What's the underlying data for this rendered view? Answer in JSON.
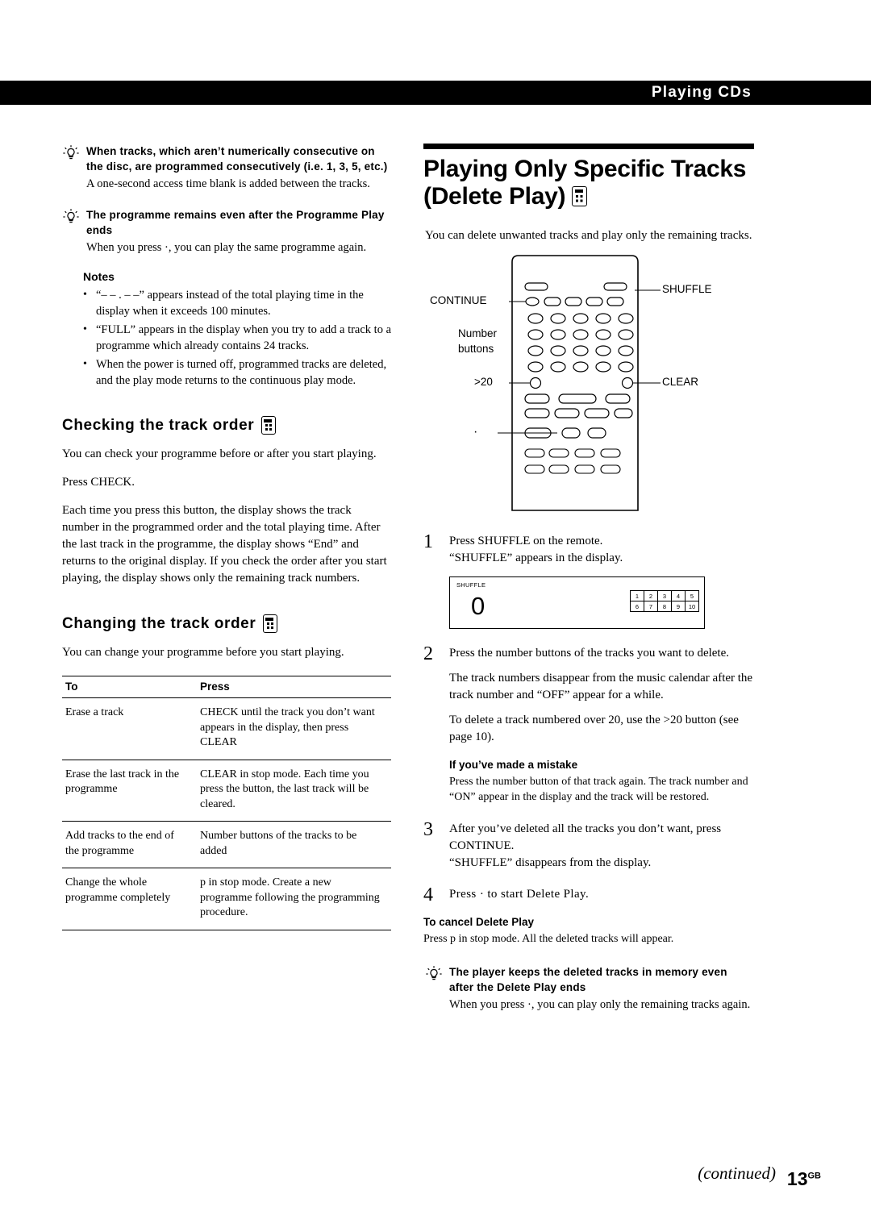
{
  "header": {
    "title": "Playing CDs"
  },
  "left": {
    "tip1": {
      "title": "When tracks, which aren’t numerically consecutive on the disc, are programmed consecutively (i.e. 1, 3, 5, etc.)",
      "body": "A one-second access time blank is added between the tracks."
    },
    "tip2": {
      "title": "The programme remains even after the Programme Play ends",
      "body": "When you press ·, you can play the same programme again."
    },
    "notes_title": "Notes",
    "notes": [
      "“– – . – –” appears instead of the total playing time in the display when it exceeds 100 minutes.",
      "“FULL” appears in the display when you try to add a track to a programme which already contains 24 tracks.",
      "When the power is turned off, programmed tracks are deleted, and the play mode returns to the continuous play mode."
    ],
    "check_head": "Checking the track order",
    "check_p1": "You can check your programme before or after you start playing.",
    "check_p2": "Press CHECK.",
    "check_p3": "Each time you press this button, the display shows the track number in the programmed order and the total playing time. After the last track in the programme, the display shows “End” and returns to the original display. If you check the order after you start playing, the display shows only the remaining track numbers.",
    "change_head": "Changing the track order",
    "change_p1": "You can change your programme before you start playing.",
    "table": {
      "headers": [
        "To",
        "Press"
      ],
      "rows": [
        [
          "Erase a track",
          "CHECK until the track you don’t want appears in the display, then press CLEAR"
        ],
        [
          "Erase the last track in the programme",
          "CLEAR in stop mode. Each time you press the button, the last track will be cleared."
        ],
        [
          "Add tracks to the end of the programme",
          "Number buttons of the tracks to be added"
        ],
        [
          "Change the whole programme completely",
          "p in stop mode. Create a new programme following the programming procedure."
        ]
      ]
    }
  },
  "right": {
    "title_line1": "Playing Only Specific Tracks",
    "title_line2": "(Delete Play)",
    "intro": "You can delete unwanted tracks and play only the remaining tracks.",
    "diagram": {
      "labels": {
        "continue": "CONTINUE",
        "number_buttons_l1": "Number",
        "number_buttons_l2": "buttons",
        "over20": ">20",
        "play": "·",
        "shuffle": "SHUFFLE",
        "clear": "CLEAR"
      }
    },
    "steps": [
      {
        "num": "1",
        "paras": [
          "Press SHUFFLE on the remote.\n“SHUFFLE” appears in the display."
        ]
      },
      {
        "num": "2",
        "paras": [
          "Press the number buttons of the tracks you want to delete.",
          "The track numbers disappear from the music calendar after the track number and “OFF” appear for a while.",
          "To delete a track numbered over 20, use the >20 button (see page 10)."
        ]
      },
      {
        "num": "3",
        "paras": [
          "After you’ve deleted all the tracks you don’t want, press CONTINUE.\n“SHUFFLE” disappears from the display."
        ]
      },
      {
        "num": "4",
        "paras": [
          "Press · to start Delete Play."
        ]
      }
    ],
    "display": {
      "shuffle_label": "SHUFFLE",
      "digit": "0",
      "calendar_row1": [
        "1",
        "2",
        "3",
        "4",
        "5"
      ],
      "calendar_row2": [
        "6",
        "7",
        "8",
        "9",
        "10"
      ]
    },
    "mistake_head": "If you’ve made a mistake",
    "mistake_body": "Press the number button of that track again. The track number and “ON” appear in the display and the track will be restored.",
    "cancel_head": "To cancel Delete Play",
    "cancel_body": "Press p in stop mode. All the deleted tracks will appear.",
    "tip": {
      "title": "The player keeps the deleted tracks in memory even after the Delete Play ends",
      "body": "When you press ·, you can play only the remaining tracks again."
    },
    "continued": "(continued)",
    "page_number": "13",
    "page_suffix": "GB"
  }
}
